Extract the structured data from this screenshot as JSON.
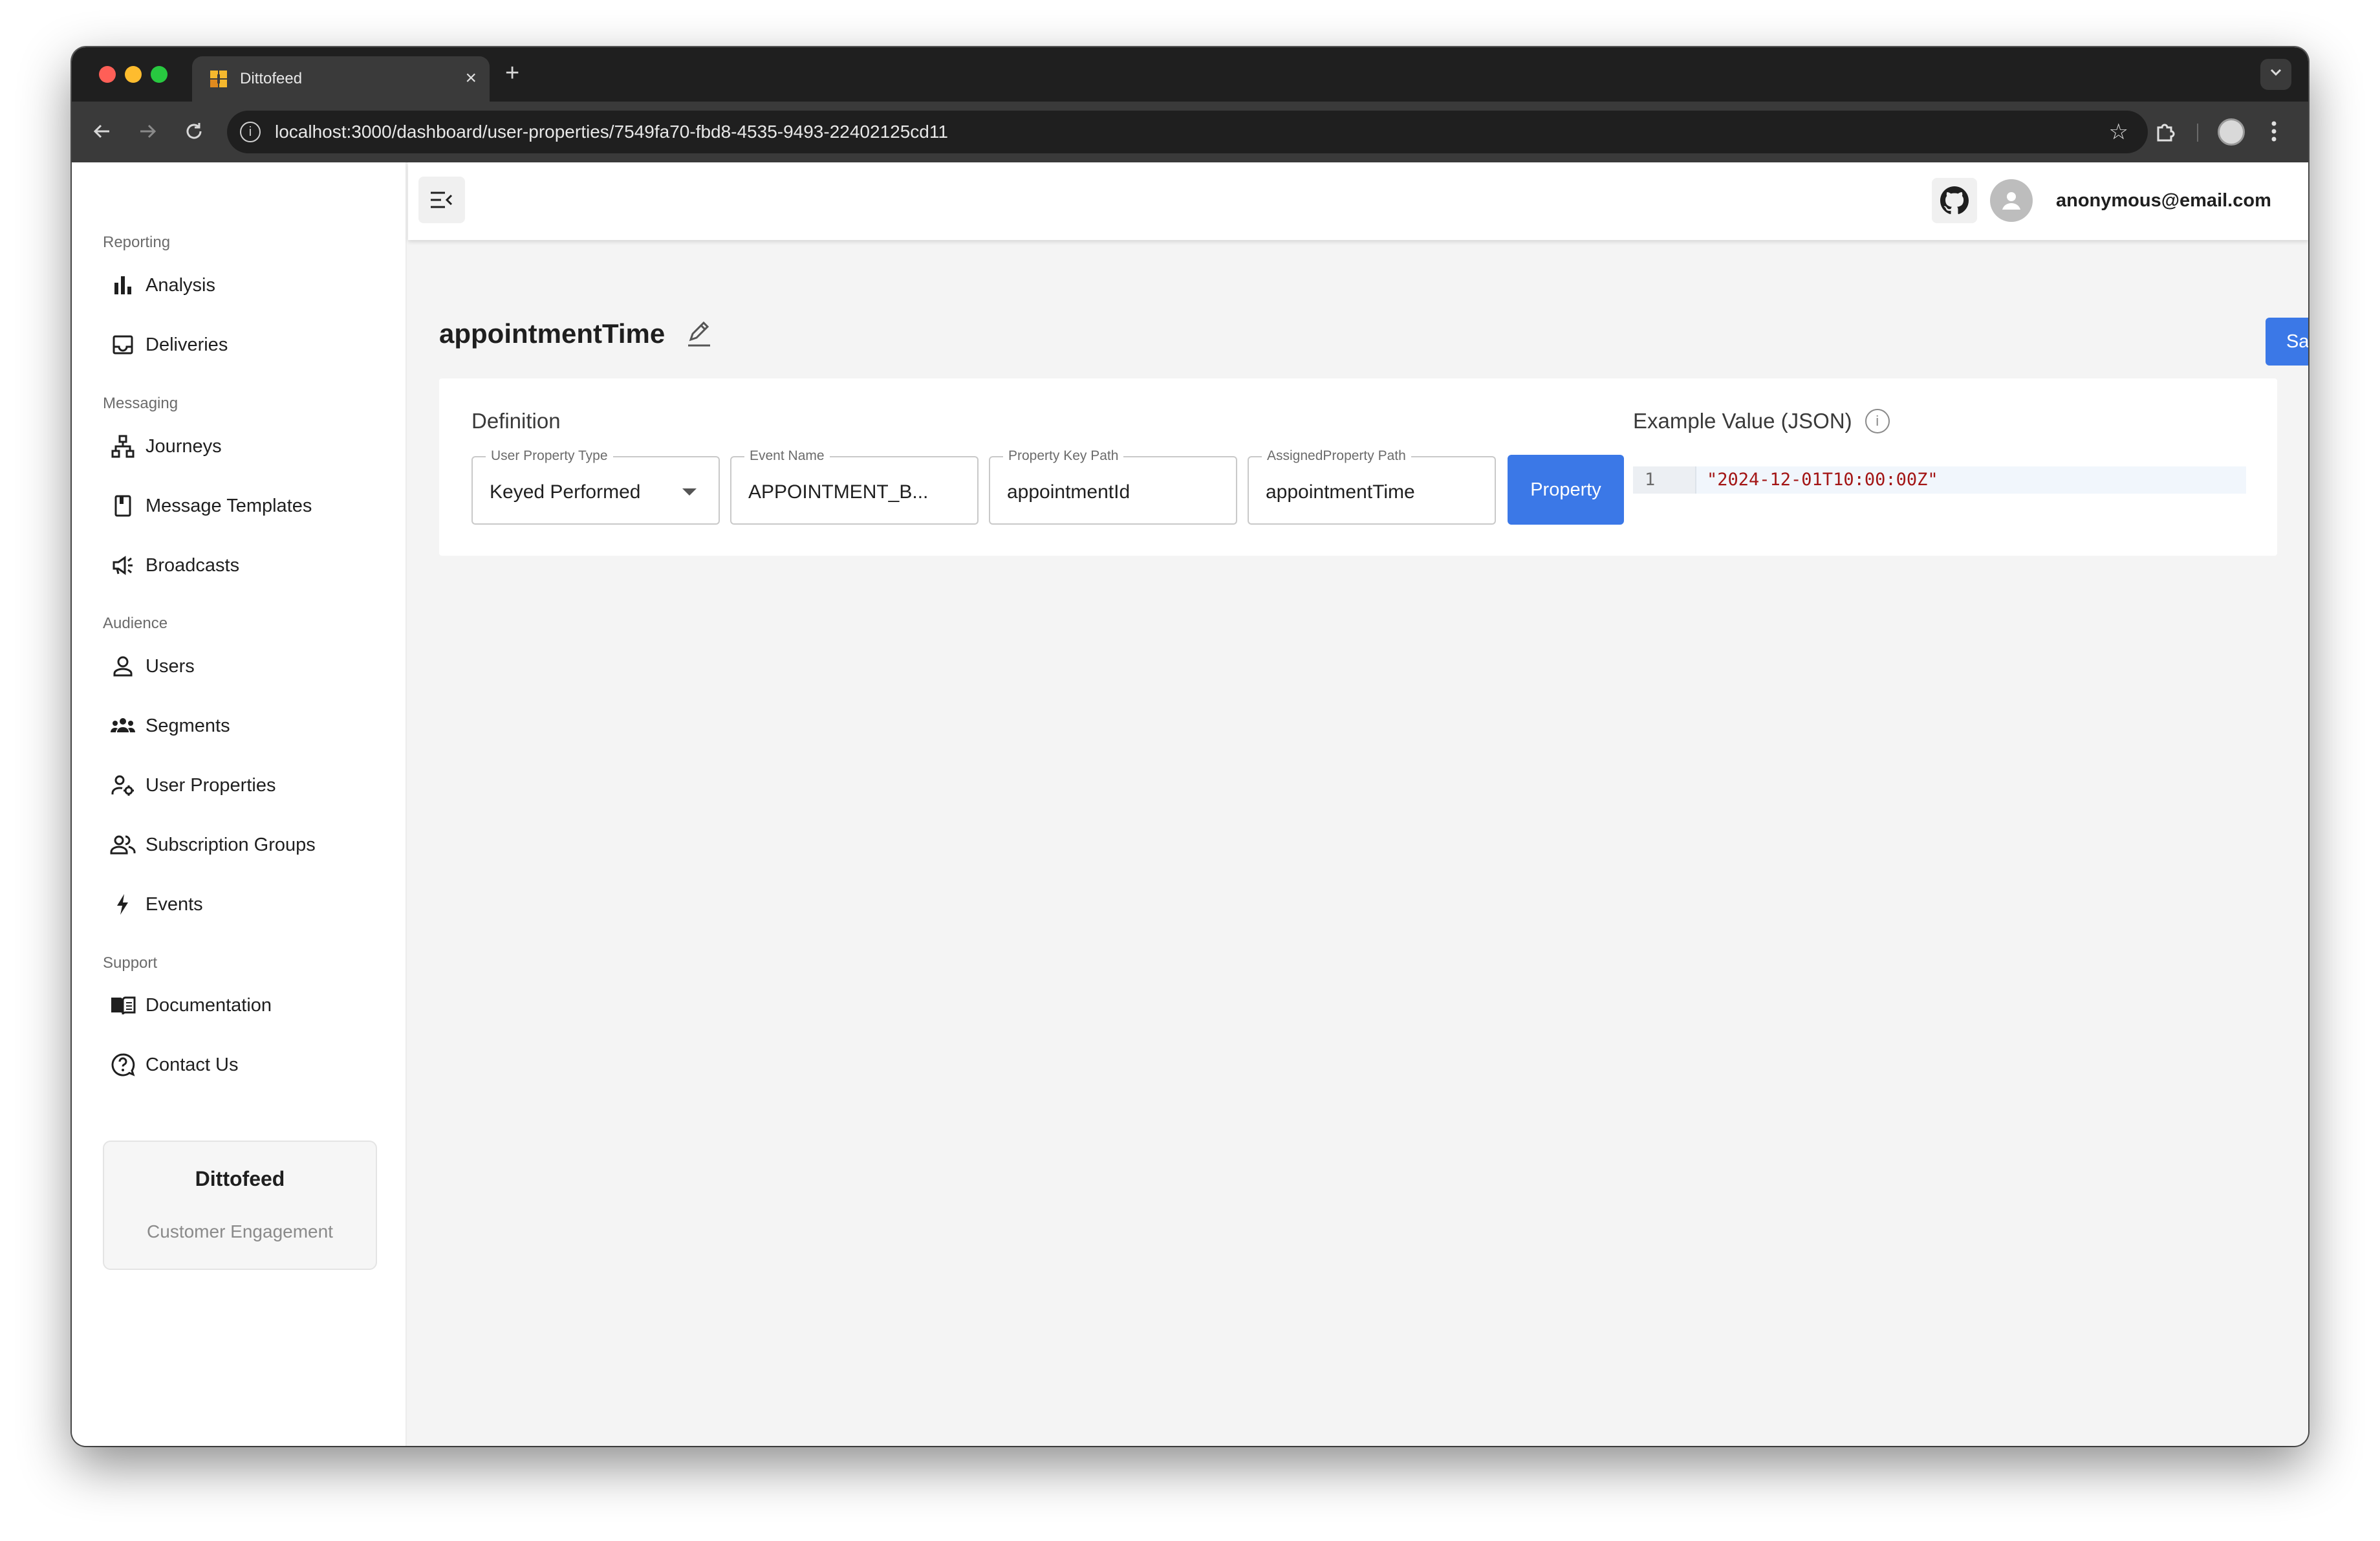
{
  "browser": {
    "tab_title": "Dittofeed",
    "tab_close": "×",
    "new_tab": "+",
    "url": "localhost:3000/dashboard/user-properties/7549fa70-fbd8-4535-9493-22402125cd11",
    "icons": [
      "back-icon",
      "forward-icon",
      "reload-icon",
      "info-icon",
      "star-icon",
      "extensions-icon",
      "profile-icon",
      "kebab-menu-icon",
      "tab-search-icon"
    ]
  },
  "sidebar": {
    "sections": [
      {
        "label": "Reporting",
        "items": [
          {
            "label": "Analysis",
            "icon": "bar-chart-icon"
          },
          {
            "label": "Deliveries",
            "icon": "inbox-icon"
          }
        ]
      },
      {
        "label": "Messaging",
        "items": [
          {
            "label": "Journeys",
            "icon": "sitemap-icon"
          },
          {
            "label": "Message Templates",
            "icon": "book-icon"
          },
          {
            "label": "Broadcasts",
            "icon": "megaphone-icon"
          }
        ]
      },
      {
        "label": "Audience",
        "items": [
          {
            "label": "Users",
            "icon": "user-icon"
          },
          {
            "label": "Segments",
            "icon": "group-icon"
          },
          {
            "label": "User Properties",
            "icon": "user-settings-icon"
          },
          {
            "label": "Subscription Groups",
            "icon": "people-icon"
          },
          {
            "label": "Events",
            "icon": "lightning-icon"
          }
        ]
      },
      {
        "label": "Support",
        "items": [
          {
            "label": "Documentation",
            "icon": "open-book-icon"
          },
          {
            "label": "Contact Us",
            "icon": "help-circle-icon"
          }
        ]
      }
    ],
    "promo": {
      "title": "Dittofeed",
      "subtitle": "Customer Engagement"
    }
  },
  "header": {
    "user_email": "anonymous@email.com"
  },
  "main": {
    "title": "appointmentTime",
    "save_label": "Save",
    "definition_label": "Definition",
    "fields": [
      {
        "legend": "User Property Type",
        "value": "Keyed Performed"
      },
      {
        "legend": "Event Name",
        "value": "APPOINTMENT_B..."
      },
      {
        "legend": "Property Key Path",
        "value": "appointmentId"
      },
      {
        "legend": "AssignedProperty Path",
        "value": "appointmentTime"
      }
    ],
    "property_button": "Property",
    "example_label": "Example Value (JSON)",
    "info_glyph": "i",
    "code": {
      "line_number": "1",
      "text": "\"2024-12-01T10:00:00Z\""
    }
  },
  "colors": {
    "accent": "#3b78e7",
    "string": "#a31515"
  }
}
